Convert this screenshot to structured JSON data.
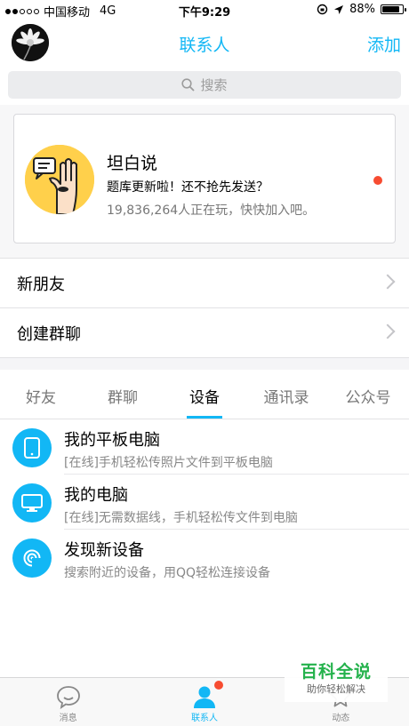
{
  "status_bar": {
    "carrier": "中国移动",
    "network": "4G",
    "time": "下午9:29",
    "battery": "88%",
    "battery_level": 0.88
  },
  "header": {
    "title": "联系人",
    "add_label": "添加"
  },
  "search": {
    "placeholder": "搜索"
  },
  "game_card": {
    "title": "坦白说",
    "subtitle": "题库更新啦！还不抢先发送？",
    "count_text": "19,836,264人正在玩，快快加入吧。"
  },
  "rows": [
    {
      "label": "新朋友"
    },
    {
      "label": "创建群聊"
    }
  ],
  "tabs": [
    {
      "label": "好友"
    },
    {
      "label": "群聊"
    },
    {
      "label": "设备",
      "active": true
    },
    {
      "label": "通讯录"
    },
    {
      "label": "公众号"
    }
  ],
  "devices": [
    {
      "name": "我的平板电脑",
      "desc": "[在线]手机轻松传照片文件到平板电脑",
      "icon": "tablet-icon"
    },
    {
      "name": "我的电脑",
      "desc": "[在线]无需数据线，手机轻松传文件到电脑",
      "icon": "monitor-icon"
    },
    {
      "name": "发现新设备",
      "desc": "搜索附近的设备，用QQ轻松连接设备",
      "icon": "radar-icon"
    }
  ],
  "tabbar": [
    {
      "label": "消息",
      "icon": "chat-bubble-icon"
    },
    {
      "label": "联系人",
      "icon": "contacts-person-icon",
      "active": true
    },
    {
      "label": "动态",
      "icon": "star-icon"
    }
  ],
  "watermark": {
    "line1": "百科全说",
    "line2": "助你轻松解决"
  },
  "colors": {
    "accent": "#12b7f5",
    "badge": "#f74c31",
    "card_logo_bg": "#ffd04b",
    "watermark_green": "#24b24c"
  }
}
